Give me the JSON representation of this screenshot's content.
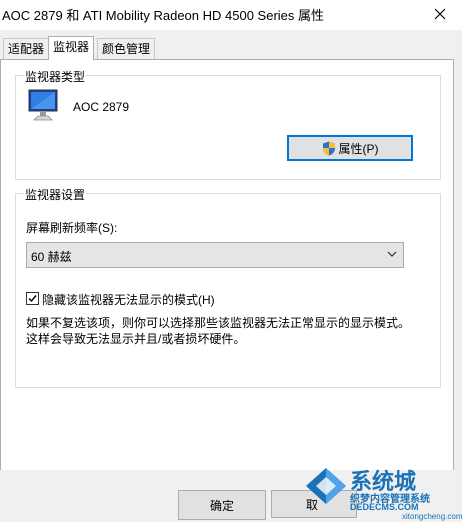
{
  "window": {
    "title": "AOC 2879 和 ATI Mobility Radeon HD 4500 Series 属性"
  },
  "tabs": [
    {
      "label": "适配器"
    },
    {
      "label": "监视器"
    },
    {
      "label": "颜色管理"
    }
  ],
  "monitor_type": {
    "legend": "监视器类型",
    "monitor_name": "AOC 2879",
    "properties_button": "属性(P)"
  },
  "monitor_settings": {
    "legend": "监视器设置",
    "refresh_label": "屏幕刷新频率(S):",
    "refresh_value": "60 赫兹",
    "hide_modes_checked": true,
    "hide_modes_label": "隐藏该监视器无法显示的模式(H)",
    "description_line1": "如果不复选该项，则你可以选择那些该监视器无法正常显示的显示模式。",
    "description_line2": "这样会导致无法显示并且/或者损坏硬件。"
  },
  "footer": {
    "ok_button": "确定",
    "cancel_button": "取"
  },
  "watermark": {
    "brand": "系统城",
    "site1": "织梦内容管理系统",
    "site2": "DEDECMS.COM",
    "site3": "xitongcheng.com"
  },
  "colors": {
    "accent": "#0078d7",
    "watermark_blue": "#1a73b8"
  }
}
